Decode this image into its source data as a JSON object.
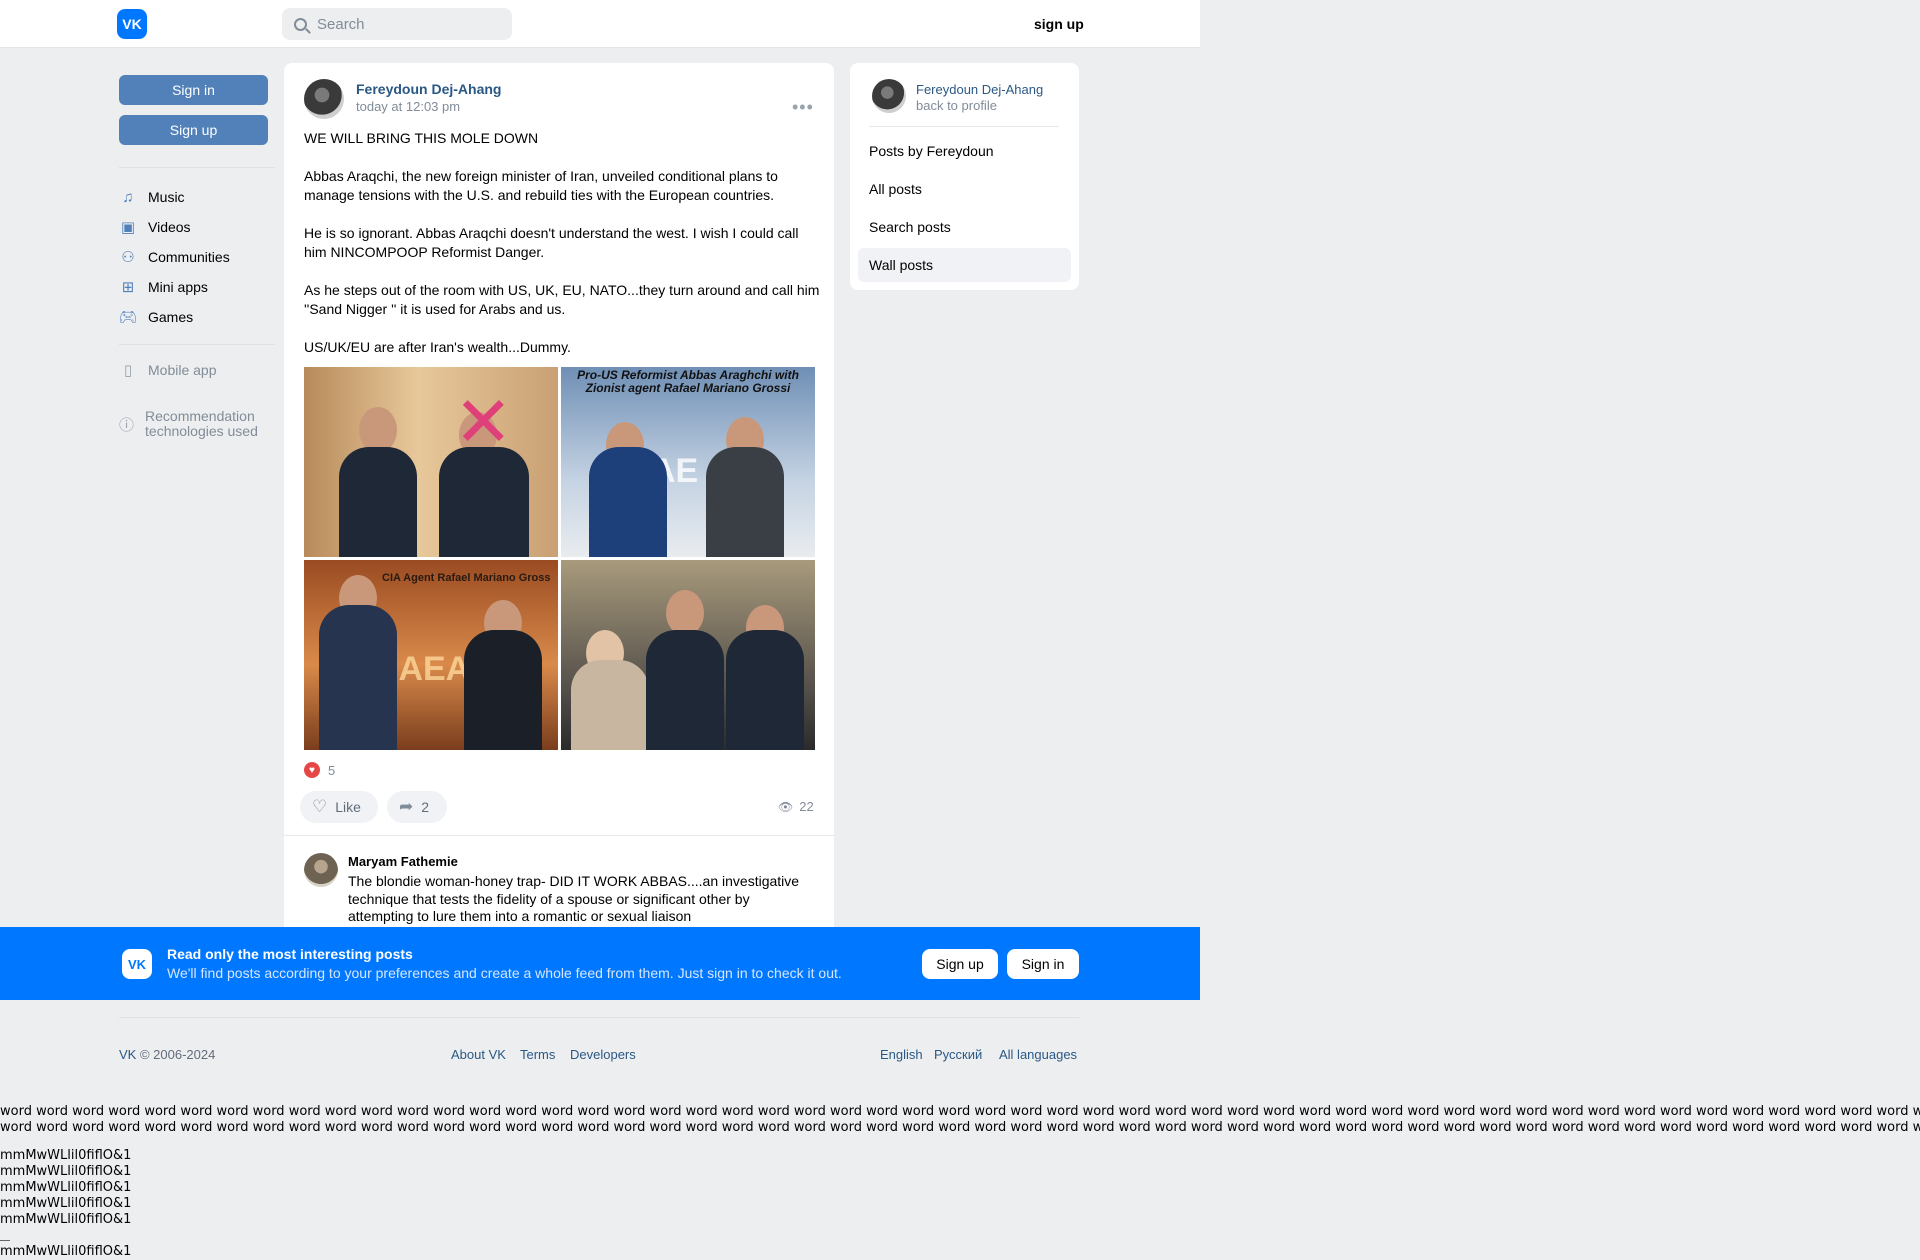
{
  "header": {
    "logo_text": "VK",
    "search_placeholder": "Search",
    "signup_label": "sign up"
  },
  "sidebar": {
    "signin_label": "Sign in",
    "signup_label": "Sign up",
    "items": [
      {
        "label": "Music",
        "icon": "music-note-icon"
      },
      {
        "label": "Videos",
        "icon": "video-icon"
      },
      {
        "label": "Communities",
        "icon": "communities-icon"
      },
      {
        "label": "Mini apps",
        "icon": "grid-icon"
      },
      {
        "label": "Games",
        "icon": "gamepad-icon"
      }
    ],
    "mobile_app": "Mobile app",
    "recommendation": "Recommendation technologies used"
  },
  "post": {
    "author": "Fereydoun Dej-Ahang",
    "time": "today at 12:03 pm",
    "paragraphs": [
      "WE WILL BRING THIS MOLE DOWN",
      "Abbas Araqchi, the new foreign minister of Iran, unveiled conditional plans to manage tensions with the U.S. and rebuild ties with the European countries.",
      "He is so ignorant. Abbas Araqchi doesn't understand the west. I wish I could call him NINCOMPOOP Reformist Danger.",
      "As he steps out of the room with US, UK, EU, NATO...they turn around and call him ''Sand Nigger '' it is used for Arabs and us.",
      "US/UK/EU are after Iran's wealth...Dummy."
    ],
    "photo_captions": {
      "photo2": "Pro-US Reformist  Abbas Araghchi with Zionist agent Rafael Mariano Grossi",
      "photo3": "CIA Agent Rafael Mariano Gross"
    },
    "reactions_count": "5",
    "like_label": "Like",
    "share_count": "2",
    "views": "22"
  },
  "comment": {
    "author": "Maryam Fathemie",
    "text": "The blondie woman-honey trap- DID IT WORK ABBAS....an investigative technique that tests the fidelity of a spouse or significant other by attempting to lure them into a romantic or sexual liaison"
  },
  "right_panel": {
    "name": "Fereydoun Dej-Ahang",
    "back": "back to profile",
    "items": [
      "Posts by Fereydoun",
      "All posts",
      "Search posts",
      "Wall posts"
    ],
    "active_item": "Wall posts"
  },
  "banner": {
    "title": "Read only the most interesting posts",
    "subtitle": "We'll find posts according to your preferences and create a whole feed from them. Just sign in to check it out.",
    "signup": "Sign up",
    "signin": "Sign in"
  },
  "footer": {
    "brand": "VK",
    "copyright": " © 2006-2024",
    "about": "About VK",
    "terms": "Terms",
    "developers": "Developers",
    "english": "English",
    "russian": "Русский",
    "all_languages": "All languages"
  },
  "overflow_text": {
    "word_line": "word word word word word word word word word word word word word word word word word word word word word word word word word word word word word word word word word word word word word word word word word word word word word word word word word word word word word word word word word word word word word word word word word word word word word",
    "sample": "mmMwWLlil0fiflO&1"
  },
  "colors": {
    "brand_blue": "#0077ff",
    "button_blue": "#5181b8",
    "link": "#2a5885",
    "page_bg": "#edeef0"
  }
}
